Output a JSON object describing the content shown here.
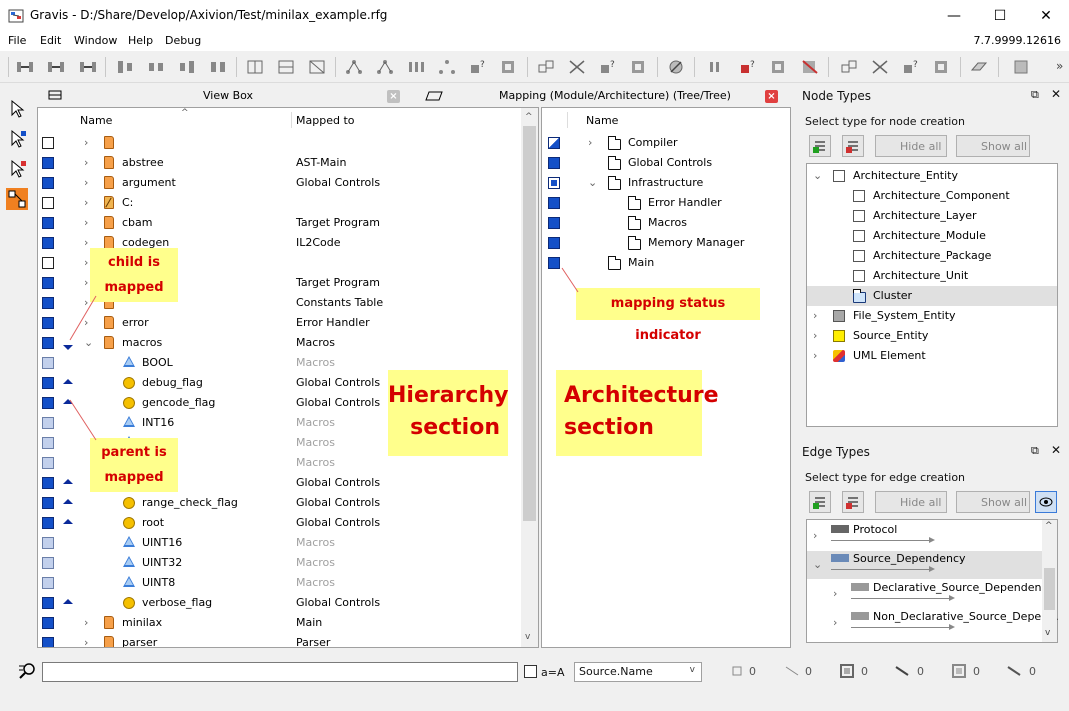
{
  "window": {
    "title": "Gravis - D:/Share/Develop/Axivion/Test/minilax_example.rfg",
    "minimize": "—",
    "maximize": "☐",
    "close": "✕"
  },
  "menu": {
    "items": [
      "File",
      "Edit",
      "Window",
      "Help",
      "Debug"
    ],
    "version": "7.7.9999.12616"
  },
  "view_box": {
    "title": "View Box",
    "col_name": "Name",
    "col_mapped": "Mapped to",
    "rows": [
      {
        "status": "empty",
        "chev": "›",
        "icon": "folder",
        "name": "",
        "mapped": "",
        "grey": false
      },
      {
        "status": "full",
        "chev": "›",
        "icon": "folder",
        "name": "abstree",
        "mapped": "AST-Main",
        "grey": false
      },
      {
        "status": "full",
        "chev": "›",
        "icon": "folder",
        "name": "argument",
        "mapped": "Global Controls",
        "grey": false
      },
      {
        "status": "empty",
        "chev": "›",
        "icon": "folder-c",
        "name": "C:",
        "mapped": "",
        "grey": false
      },
      {
        "status": "full",
        "chev": "›",
        "icon": "folder",
        "name": "cbam",
        "mapped": "Target Program",
        "grey": false
      },
      {
        "status": "full",
        "chev": "›",
        "icon": "folder",
        "name": "codegen",
        "mapped": "IL2Code",
        "grey": false
      },
      {
        "status": "empty",
        "chev": "›",
        "icon": "folder",
        "name": "",
        "mapped": "",
        "grey": false
      },
      {
        "status": "full",
        "chev": "›",
        "icon": "folder",
        "name": "",
        "mapped": "Target Program",
        "grey": false
      },
      {
        "status": "full",
        "chev": "›",
        "icon": "folder",
        "name": "",
        "mapped": "Constants Table",
        "grey": false
      },
      {
        "status": "full",
        "chev": "›",
        "icon": "folder",
        "name": "error",
        "mapped": "Error Handler",
        "grey": false
      },
      {
        "status": "full",
        "chev": "⌄",
        "icon": "folder",
        "name": "macros",
        "mapped": "Macros",
        "grey": false,
        "arrow": "down"
      },
      {
        "status": "light",
        "chev": "",
        "icon": "tri",
        "name": "BOOL",
        "mapped": "Macros",
        "grey": true
      },
      {
        "status": "full",
        "chev": "",
        "icon": "hex",
        "name": "debug_flag",
        "mapped": "Global Controls",
        "grey": false,
        "arrow": "up"
      },
      {
        "status": "full",
        "chev": "",
        "icon": "hex",
        "name": "gencode_flag",
        "mapped": "Global Controls",
        "grey": false,
        "arrow": "up"
      },
      {
        "status": "light",
        "chev": "",
        "icon": "tri",
        "name": "INT16",
        "mapped": "Macros",
        "grey": true
      },
      {
        "status": "light",
        "chev": "",
        "icon": "tri",
        "name": "",
        "mapped": "Macros",
        "grey": true
      },
      {
        "status": "light",
        "chev": "",
        "icon": "tri",
        "name": "",
        "mapped": "Macros",
        "grey": true
      },
      {
        "status": "full",
        "chev": "",
        "icon": "hex",
        "name": "_flag",
        "mapped": "Global Controls",
        "grey": false,
        "arrow": "up"
      },
      {
        "status": "full",
        "chev": "",
        "icon": "hex",
        "name": "range_check_flag",
        "mapped": "Global Controls",
        "grey": false,
        "arrow": "up"
      },
      {
        "status": "full",
        "chev": "",
        "icon": "hex",
        "name": "root",
        "mapped": "Global Controls",
        "grey": false,
        "arrow": "up"
      },
      {
        "status": "light",
        "chev": "",
        "icon": "tri",
        "name": "UINT16",
        "mapped": "Macros",
        "grey": true
      },
      {
        "status": "light",
        "chev": "",
        "icon": "tri",
        "name": "UINT32",
        "mapped": "Macros",
        "grey": true
      },
      {
        "status": "light",
        "chev": "",
        "icon": "tri",
        "name": "UINT8",
        "mapped": "Macros",
        "grey": true
      },
      {
        "status": "full",
        "chev": "",
        "icon": "hex",
        "name": "verbose_flag",
        "mapped": "Global Controls",
        "grey": false,
        "arrow": "up"
      },
      {
        "status": "full",
        "chev": "›",
        "icon": "folder",
        "name": "minilax",
        "mapped": "Main",
        "grey": false
      },
      {
        "status": "full",
        "chev": "›",
        "icon": "folder",
        "name": "parser",
        "mapped": "Parser",
        "grey": false
      }
    ]
  },
  "mapping": {
    "title": "Mapping (Module/Architecture) (Tree/Tree)",
    "col_name": "Name",
    "rows": [
      {
        "status": "half",
        "chev": "›",
        "name": "Compiler",
        "indent": 0
      },
      {
        "status": "full",
        "chev": "",
        "name": "Global Controls",
        "indent": 0
      },
      {
        "status": "mid",
        "chev": "⌄",
        "name": "Infrastructure",
        "indent": 0
      },
      {
        "status": "full",
        "chev": "",
        "name": "Error Handler",
        "indent": 1
      },
      {
        "status": "full",
        "chev": "",
        "name": "Macros",
        "indent": 1
      },
      {
        "status": "full",
        "chev": "",
        "name": "Memory Manager",
        "indent": 1
      },
      {
        "status": "full",
        "chev": "",
        "name": "Main",
        "indent": 0
      }
    ]
  },
  "annotations": {
    "child_mapped": "child is\nmapped",
    "parent_mapped": "parent is\nmapped",
    "mapping_status": "mapping status indicator",
    "hierarchy": "Hierarchy\nsection",
    "architecture": "Architecture\nsection"
  },
  "node_types": {
    "title": "Node Types",
    "subtitle": "Select type for node creation",
    "hide_all": "Hide all",
    "show_all": "Show all",
    "items": [
      {
        "name": "Architecture_Entity",
        "level": 0,
        "chev": "⌄",
        "box": "white"
      },
      {
        "name": "Architecture_Component",
        "level": 1,
        "chev": "",
        "box": "white"
      },
      {
        "name": "Architecture_Layer",
        "level": 1,
        "chev": "",
        "box": "white"
      },
      {
        "name": "Architecture_Module",
        "level": 1,
        "chev": "",
        "box": "white"
      },
      {
        "name": "Architecture_Package",
        "level": 1,
        "chev": "",
        "box": "white"
      },
      {
        "name": "Architecture_Unit",
        "level": 1,
        "chev": "",
        "box": "white"
      },
      {
        "name": "Cluster",
        "level": 1,
        "chev": "",
        "box": "folder",
        "selected": true
      },
      {
        "name": "File_System_Entity",
        "level": 0,
        "chev": "›",
        "box": "grey"
      },
      {
        "name": "Source_Entity",
        "level": 0,
        "chev": "›",
        "box": "yellow"
      },
      {
        "name": "UML Element",
        "level": 0,
        "chev": "›",
        "box": "uml"
      }
    ]
  },
  "edge_types": {
    "title": "Edge Types",
    "subtitle": "Select type for edge creation",
    "hide_all": "Hide all",
    "show_all": "Show all",
    "items": [
      {
        "name": "Protocol",
        "level": 0,
        "chev": "›"
      },
      {
        "name": "Source_Dependency",
        "level": 0,
        "chev": "⌄",
        "selected": true
      },
      {
        "name": "Declarative_Source_Dependency",
        "level": 1,
        "chev": "›"
      },
      {
        "name": "Non_Declarative_Source_Depen...",
        "level": 1,
        "chev": "›"
      }
    ]
  },
  "bottom": {
    "search_value": "",
    "case_label": "a=A",
    "source_select": "Source.Name",
    "counts": [
      "0",
      "0",
      "0",
      "0",
      "0",
      "0"
    ]
  },
  "colors": {
    "mapped": "#1450c8",
    "note_bg": "#ffff8c",
    "note_text": "#d40000"
  }
}
